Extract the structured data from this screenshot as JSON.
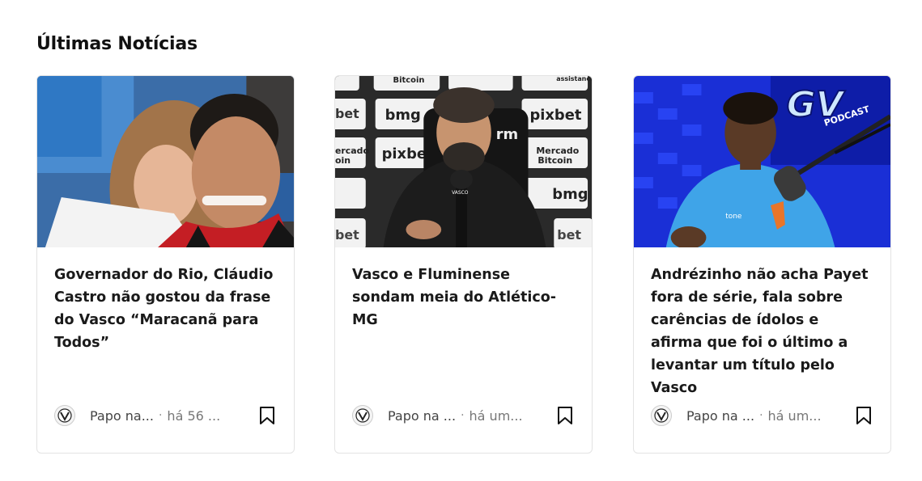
{
  "section": {
    "title": "Últimas Notícias"
  },
  "cards": [
    {
      "title": "Governador do Rio, Cláudio Castro não gostou da frase do Vasco “Maracanã para Todos”",
      "source": "Papo na...",
      "time": "há 56 ..."
    },
    {
      "title": "Vasco e Fluminense sondam meia do Atlético-MG",
      "source": "Papo na ...",
      "time": "há um..."
    },
    {
      "title": "Andrézinho não acha Payet fora de série, fala sobre carências de ídolos e afirma que foi o último a levantar um título pelo Vasco",
      "source": "Papo na ...",
      "time": "há um..."
    }
  ],
  "backdrop_texts": {
    "bitcoin": "Bitcoin",
    "assistance": "assistance",
    "bet_left": "bet",
    "bmg": "bmg",
    "pixbet": "pixbet",
    "mercado_left": "ercado",
    "coin": "oin",
    "pixbe": "pixbe",
    "mercado": "Mercado",
    "bitcoin2": "Bitcoin",
    "bmg2": "bmg",
    "bet_bottom": "bet",
    "bet_right": "bet",
    "rm": "rm",
    "vasco_mic": "VASCO",
    "gv": "GV",
    "podcast": "PODCAST",
    "tone": "tone"
  },
  "colors": {
    "card_border": "#e3e3e3",
    "title": "#1a1a1a",
    "meta": "#777777"
  }
}
